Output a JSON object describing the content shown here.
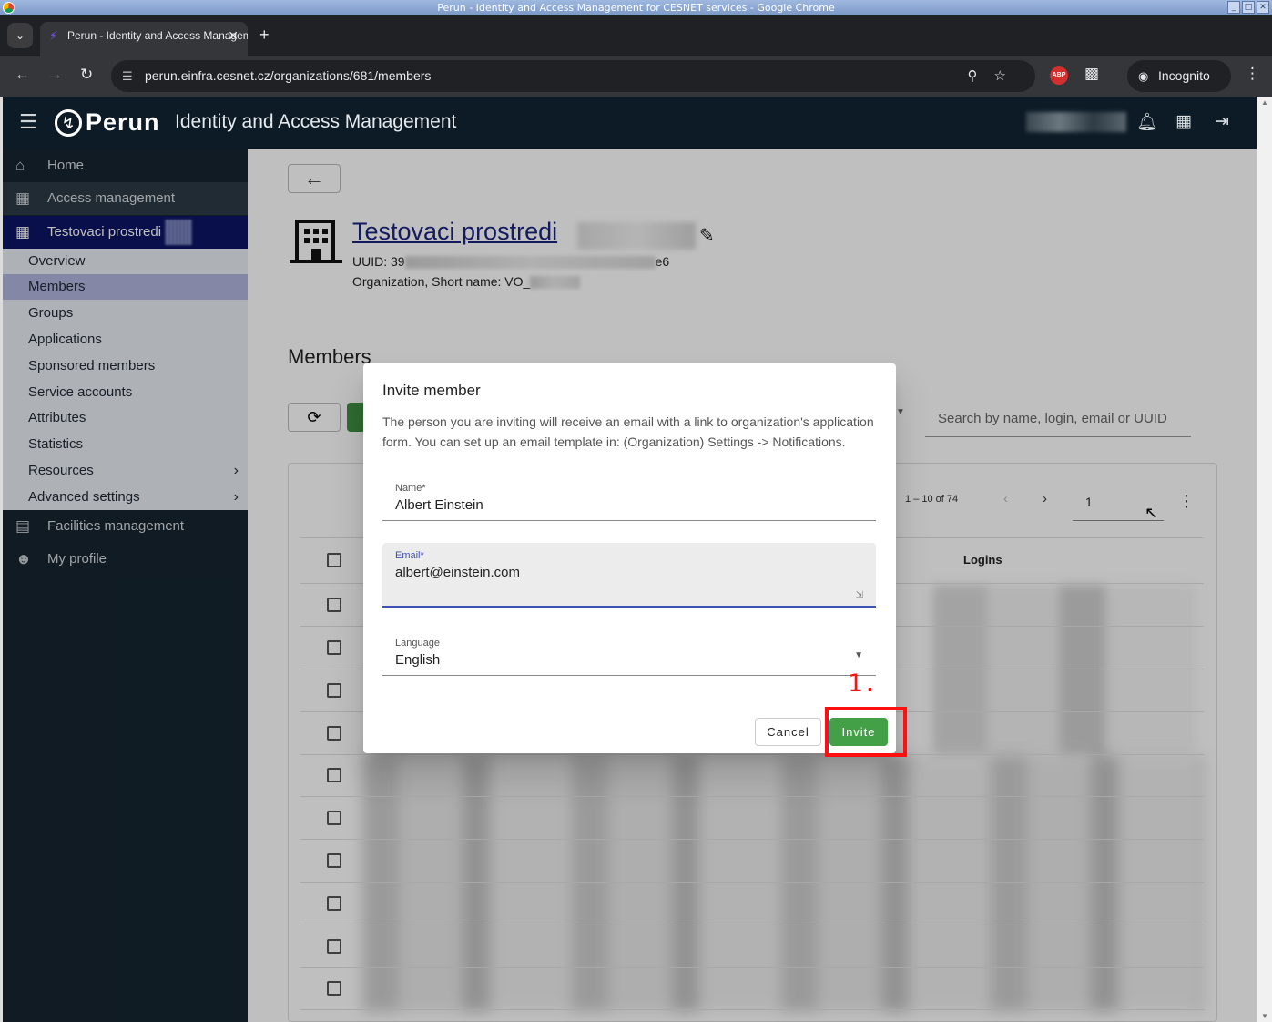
{
  "window": {
    "title": "Perun - Identity and Access Management for CESNET services - Google Chrome",
    "buttons": [
      "_",
      "□",
      "✕"
    ]
  },
  "browser": {
    "tab_title": "Perun - Identity and Access Management for CESNET services",
    "url": "perun.einfra.cesnet.cz/organizations/681/members",
    "incognito_label": "Incognito",
    "abp_label": "ABP"
  },
  "app": {
    "logo": "Perun",
    "title": "Identity and Access Management"
  },
  "sidebar": {
    "items": [
      {
        "label": "Home",
        "icon": "home-icon"
      },
      {
        "label": "Access management",
        "icon": "building-icon"
      },
      {
        "label": "Testovaci prostredi",
        "icon": "building-icon"
      }
    ],
    "submenu": [
      {
        "label": "Overview"
      },
      {
        "label": "Members"
      },
      {
        "label": "Groups"
      },
      {
        "label": "Applications"
      },
      {
        "label": "Sponsored members"
      },
      {
        "label": "Service accounts"
      },
      {
        "label": "Attributes"
      },
      {
        "label": "Statistics"
      },
      {
        "label": "Resources"
      },
      {
        "label": "Advanced settings"
      }
    ],
    "bottom": [
      {
        "label": "Facilities management",
        "icon": "facility-icon"
      },
      {
        "label": "My profile",
        "icon": "person-icon"
      }
    ]
  },
  "org": {
    "name": "Testovaci prostredi",
    "uuid_prefix": "UUID: 39",
    "uuid_suffix": "e6",
    "short_name_prefix": "Organization, Short name: VO_"
  },
  "members": {
    "heading": "Members",
    "search_placeholder": "Search by name, login, email or UUID",
    "pager_text": "1 – 10 of 74",
    "page_value": "1",
    "column_logins": "Logins"
  },
  "dialog": {
    "title": "Invite member",
    "description": "The person you are inviting will receive an email with a link to organization's application form. You can set up an email template in: (Organization) Settings -> Notifications.",
    "name_label": "Name*",
    "name_value": "Albert Einstein",
    "email_label": "Email*",
    "email_value": "albert@einstein.com",
    "language_label": "Language",
    "language_value": "English",
    "cancel_label": "Cancel",
    "invite_label": "Invite"
  },
  "annotation": {
    "step": "1.",
    "color": "#ff1010"
  }
}
